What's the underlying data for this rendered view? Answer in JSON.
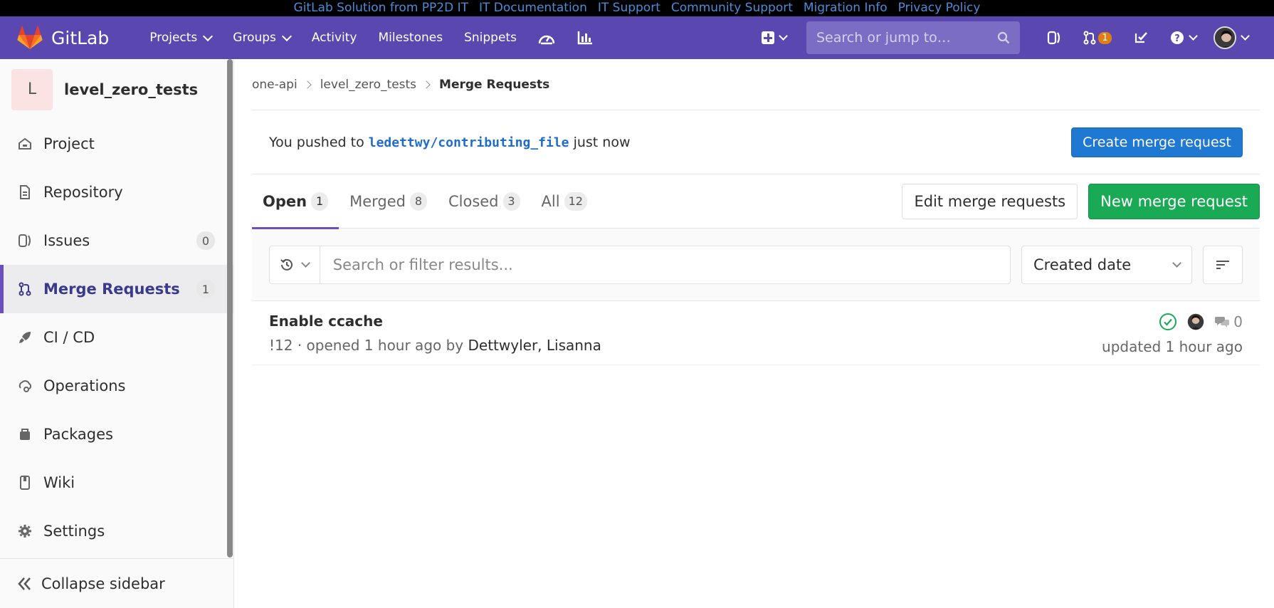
{
  "system_header": {
    "links": [
      "GitLab Solution from PP2D IT",
      "IT Documentation",
      "IT Support",
      "Community Support",
      "Migration Info",
      "Privacy Policy"
    ]
  },
  "navbar": {
    "brand": "GitLab",
    "links": [
      "Projects",
      "Groups",
      "Activity",
      "Milestones",
      "Snippets"
    ],
    "search_placeholder": "Search or jump to…",
    "mr_count": "1"
  },
  "sidebar": {
    "context_letter": "L",
    "context_name": "level_zero_tests",
    "items": [
      {
        "label": "Project"
      },
      {
        "label": "Repository"
      },
      {
        "label": "Issues",
        "count": "0"
      },
      {
        "label": "Merge Requests",
        "count": "1"
      },
      {
        "label": "CI / CD"
      },
      {
        "label": "Operations"
      },
      {
        "label": "Packages"
      },
      {
        "label": "Wiki"
      },
      {
        "label": "Settings"
      }
    ],
    "collapse_label": "Collapse sidebar"
  },
  "breadcrumb": [
    "one-api",
    "level_zero_tests",
    "Merge Requests"
  ],
  "push_banner": {
    "prefix": "You pushed to",
    "branch": "ledettwy/contributing_file",
    "suffix": "just now",
    "button": "Create merge request"
  },
  "tabs": [
    {
      "label": "Open",
      "count": "1"
    },
    {
      "label": "Merged",
      "count": "8"
    },
    {
      "label": "Closed",
      "count": "3"
    },
    {
      "label": "All",
      "count": "12"
    }
  ],
  "actions": {
    "edit": "Edit merge requests",
    "new": "New merge request"
  },
  "filter": {
    "placeholder": "Search or filter results...",
    "sort_label": "Created date"
  },
  "merge_requests": [
    {
      "title": "Enable ccache",
      "meta": "!12 · opened 1 hour ago by",
      "author": "Dettwyler, Lisanna",
      "comments": "0",
      "updated": "updated 1 hour ago"
    }
  ],
  "colors": {
    "navbar": "#5a47b0",
    "accent": "#6b4fbb",
    "blue_button": "#1f78d1",
    "green_button": "#1aaa55"
  }
}
